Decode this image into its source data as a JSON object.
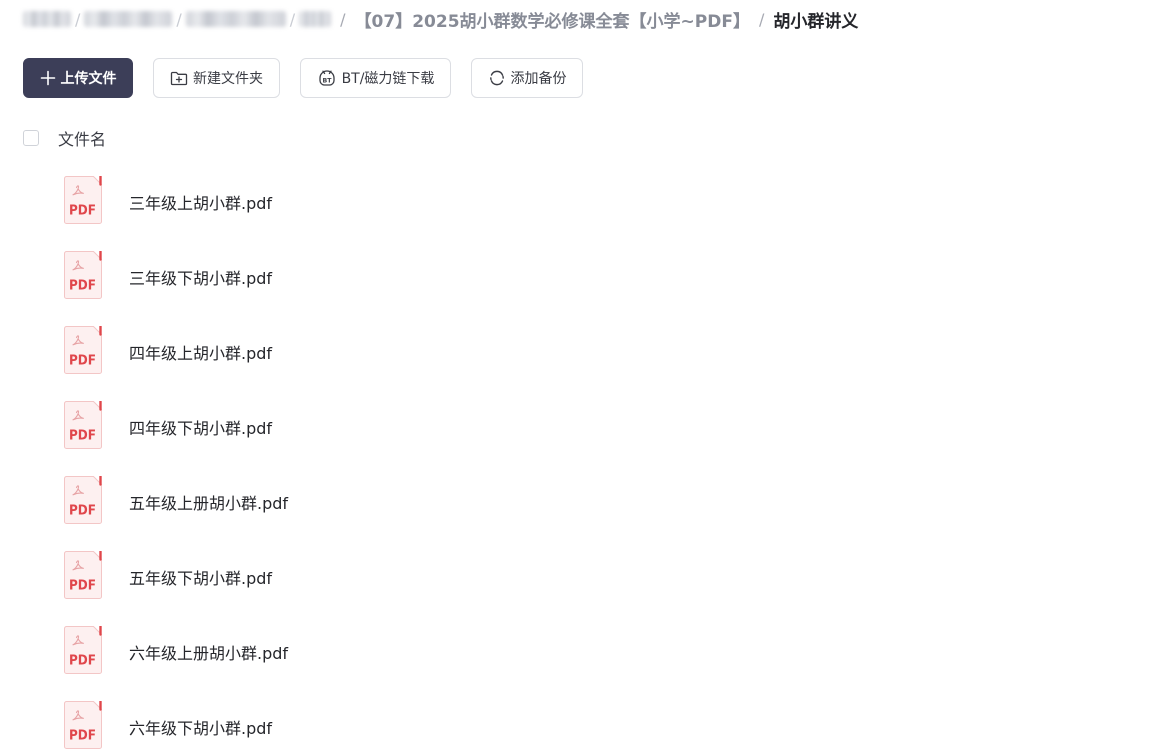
{
  "breadcrumb": {
    "folder": "【07】2025胡小群数学必修课全套【小学~PDF】",
    "current": "胡小群讲义",
    "separator": "/"
  },
  "toolbar": {
    "upload_label": "上传文件",
    "new_folder_label": "新建文件夹",
    "bt_download_label": "BT/磁力链下载",
    "add_backup_label": "添加备份"
  },
  "list": {
    "name_header": "文件名",
    "file_type_label": "PDF",
    "files": [
      {
        "name": "三年级上胡小群.pdf"
      },
      {
        "name": "三年级下胡小群.pdf"
      },
      {
        "name": "四年级上胡小群.pdf"
      },
      {
        "name": "四年级下胡小群.pdf"
      },
      {
        "name": "五年级上册胡小群.pdf"
      },
      {
        "name": "五年级下胡小群.pdf"
      },
      {
        "name": "六年级上册胡小群.pdf"
      },
      {
        "name": "六年级下胡小群.pdf"
      }
    ]
  },
  "colors": {
    "primary_button": "#3c3e58",
    "pdf_red": "#e0464b",
    "pdf_bg": "#fdf0f0",
    "text_main": "#25262b",
    "text_muted": "#878b96"
  },
  "icons": {
    "upload": "plus-icon",
    "new_folder": "folder-plus-icon",
    "bt": "bt-magnet-icon",
    "backup": "sync-icon",
    "file": "pdf-file-icon"
  }
}
